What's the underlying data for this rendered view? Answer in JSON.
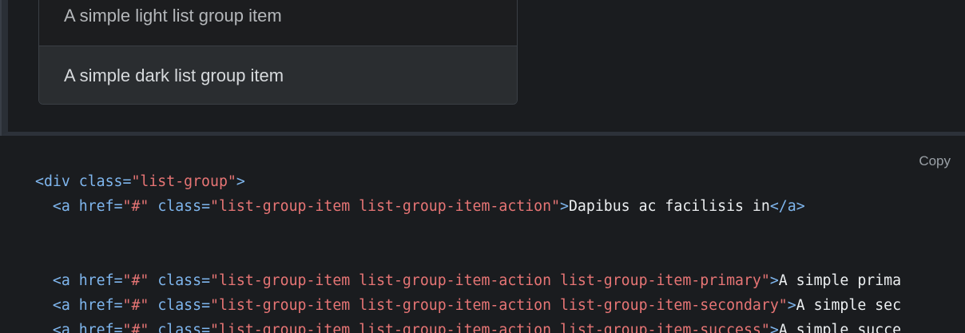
{
  "example": {
    "items": [
      {
        "label": "A simple light list group item",
        "variant": "light"
      },
      {
        "label": "A simple dark list group item",
        "variant": "dark"
      }
    ]
  },
  "code": {
    "copy_label": "Copy",
    "lines": [
      {
        "indent": "",
        "open": "<div ",
        "attr": "class=",
        "value": "\"list-group\"",
        "close": ">",
        "text": "",
        "end": ""
      },
      {
        "indent": "  ",
        "open": "<a ",
        "attr": "href=",
        "value": "\"#\"",
        "attr2": " class=",
        "value2": "\"list-group-item list-group-item-action\"",
        "close": ">",
        "text": "Dapibus ac facilisis in",
        "end": "</a>"
      },
      {
        "blank": true
      },
      {
        "blank": true
      },
      {
        "indent": "  ",
        "open": "<a ",
        "attr": "href=",
        "value": "\"#\"",
        "attr2": " class=",
        "value2": "\"list-group-item list-group-item-action list-group-item-primary\"",
        "close": ">",
        "text": "A simple prima",
        "end": ""
      },
      {
        "indent": "  ",
        "open": "<a ",
        "attr": "href=",
        "value": "\"#\"",
        "attr2": " class=",
        "value2": "\"list-group-item list-group-item-action list-group-item-secondary\"",
        "close": ">",
        "text": "A simple sec",
        "end": ""
      },
      {
        "indent": "  ",
        "open": "<a ",
        "attr": "href=",
        "value": "\"#\"",
        "attr2": " class=",
        "value2": "\"list-group-item list-group-item-action list-group-item-success\"",
        "close": ">",
        "text": "A simple succe",
        "end": ""
      }
    ]
  },
  "colors": {
    "background": "#1a1c1f",
    "tag": "#7fb6ee",
    "string": "#e77575",
    "text": "#eceff1"
  }
}
